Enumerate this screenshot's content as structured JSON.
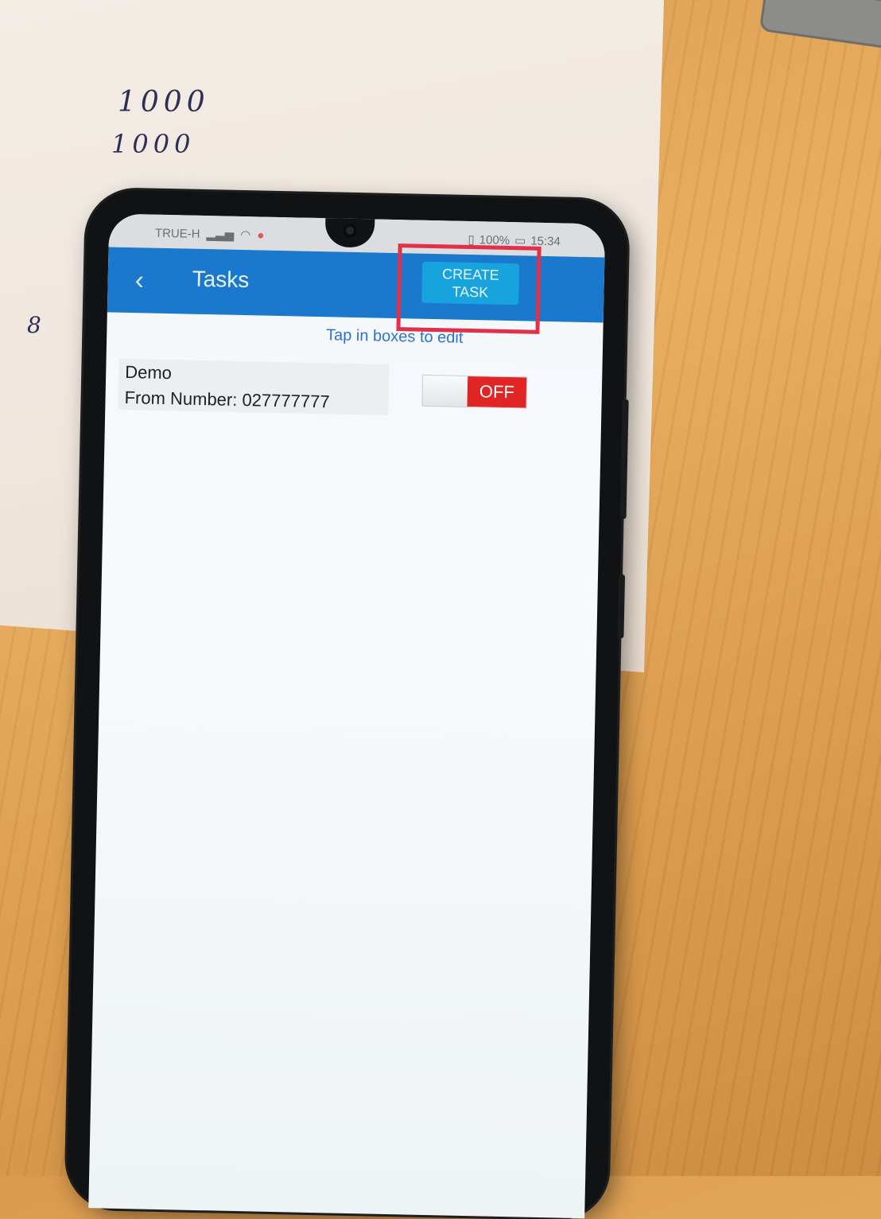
{
  "status_bar": {
    "carrier": "TRUE-H",
    "battery": "100%",
    "time": "15:34"
  },
  "app_bar": {
    "title": "Tasks",
    "create_label_line1": "CREATE",
    "create_label_line2": "TASK"
  },
  "hint": "Tap in boxes to edit",
  "tasks": [
    {
      "name": "Demo",
      "from": "From Number: 027777777",
      "toggle": "OFF"
    }
  ],
  "paper_notes": [
    "1000",
    "1000",
    "8"
  ],
  "colors": {
    "app_bar": "#1a78cd",
    "create_button": "#16a3de",
    "highlight": "#e0304a",
    "toggle_off": "#e12424"
  }
}
